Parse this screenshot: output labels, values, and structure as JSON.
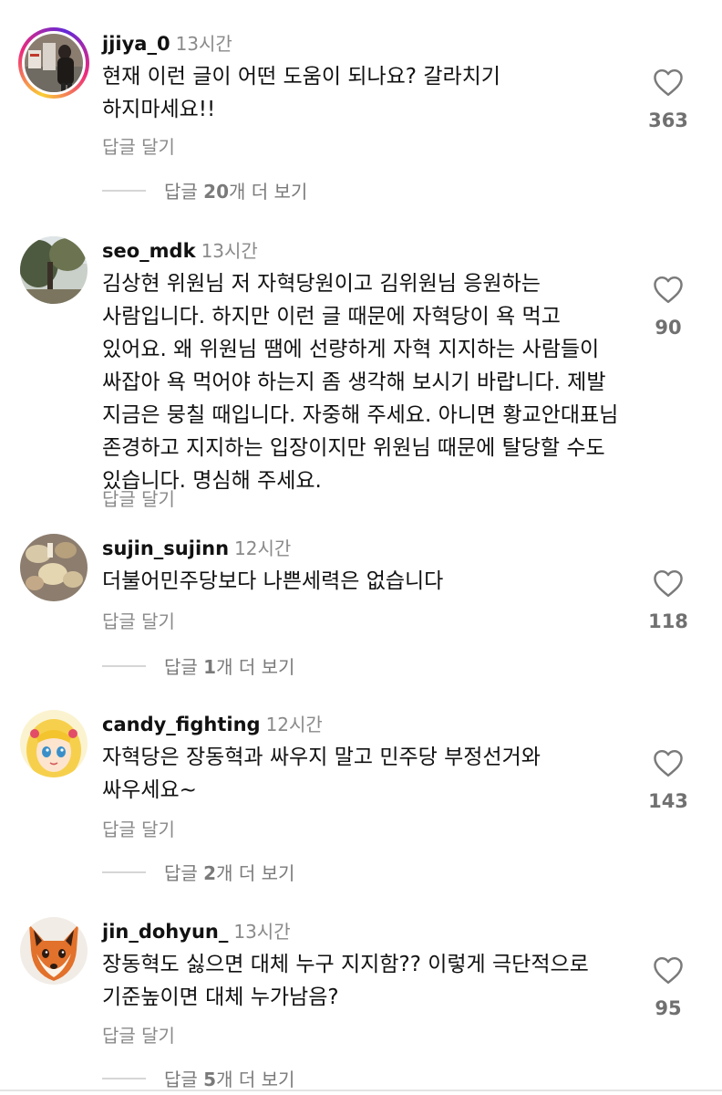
{
  "comments": [
    {
      "username": "jjiya_0",
      "time": "13시간",
      "text": "현재 이런 글이 어떤 도움이 되나요? 갈라치기 하지마세요!!",
      "likes": "363",
      "reply_label": "답글 달기",
      "view_replies": {
        "prefix": "답글 ",
        "count": "20",
        "suffix": "개 더 보기"
      },
      "avatar_icon": "story-ring-photo-avatar"
    },
    {
      "username": "seo_mdk",
      "time": "13시간",
      "text": "김상현 위원님 저 자혁당원이고 김위원님 응원하는 사람입니다. 하지만 이런 글 때문에 자혁당이 욕 먹고 있어요. 왜 위원님 땜에 선량하게 자혁 지지하는 사람들이 싸잡아 욕 먹어야 하는지 좀 생각해 보시기 바랍니다. 제발 지금은 뭉칠 때입니다. 자중해 주세요. 아니면 황교안대표님 존경하고 지지하는 입장이지만 위원님 때문에 탈당할 수도 있습니다. 명심해 주세요.",
      "likes": "90",
      "reply_label": "답글 달기",
      "avatar_icon": "tree-photo-avatar"
    },
    {
      "username": "sujin_sujinn",
      "time": "12시간",
      "text": "더불어민주당보다 나쁜세력은 없습니다",
      "likes": "118",
      "reply_label": "답글 달기",
      "view_replies": {
        "prefix": "답글 ",
        "count": "1",
        "suffix": "개 더 보기"
      },
      "avatar_icon": "food-photo-avatar"
    },
    {
      "username": "candy_fighting",
      "time": "12시간",
      "text": "자혁당은 장동혁과 싸우지 말고 민주당 부정선거와 싸우세요~",
      "likes": "143",
      "reply_label": "답글 달기",
      "view_replies": {
        "prefix": "답글 ",
        "count": "2",
        "suffix": "개 더 보기"
      },
      "avatar_icon": "cartoon-girl-avatar"
    },
    {
      "username": "jin_dohyun_",
      "time": "13시간",
      "text": "장동혁도 싫으면 대체 누구 지지함?? 이렇게 극단적으로 기준높이면 대체 누가남음?",
      "likes": "95",
      "reply_label": "답글 달기",
      "view_replies": {
        "prefix": "답글 ",
        "count": "5",
        "suffix": "개 더 보기"
      },
      "avatar_icon": "fox-avatar"
    }
  ],
  "colors": {
    "secondary_text": "#8a8a8a",
    "like_count": "#707070",
    "divider": "#d6d6d6",
    "story_ring": [
      "#f9ce34",
      "#ee2a7b",
      "#6228d7"
    ]
  }
}
